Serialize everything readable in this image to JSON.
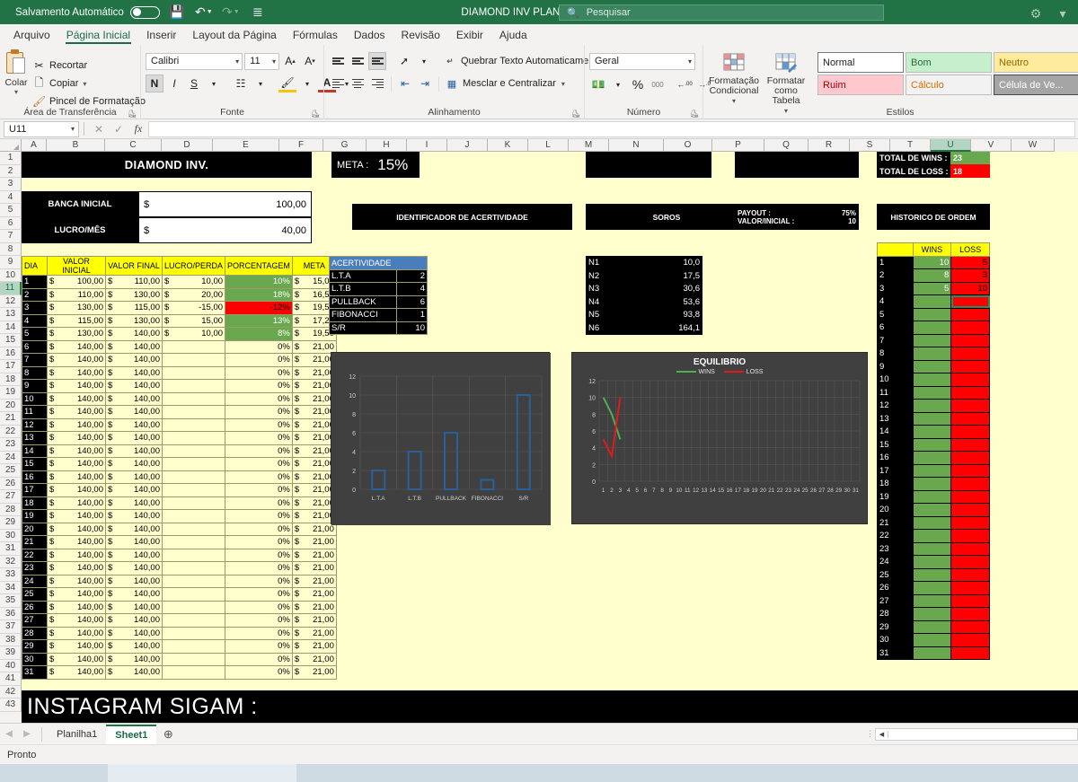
{
  "titlebar": {
    "autosave_label": "Salvamento Automático",
    "autosave_state": "off",
    "save_icon": "save-icon",
    "undo_icon": "undo-icon",
    "redo_icon": "redo-icon",
    "customize_icon": "customize-quick-access-icon",
    "document_title": "DIAMOND INV PLANILHA  -  Excel",
    "search_placeholder": "Pesquisar",
    "accent_color": "#217346"
  },
  "ribbon_tabs": [
    {
      "label": "Arquivo",
      "active": false
    },
    {
      "label": "Página Inicial",
      "active": true
    },
    {
      "label": "Inserir",
      "active": false
    },
    {
      "label": "Layout da Página",
      "active": false
    },
    {
      "label": "Fórmulas",
      "active": false
    },
    {
      "label": "Dados",
      "active": false
    },
    {
      "label": "Revisão",
      "active": false
    },
    {
      "label": "Exibir",
      "active": false
    },
    {
      "label": "Ajuda",
      "active": false
    }
  ],
  "ribbon": {
    "clipboard": {
      "group_label": "Área de Transferência",
      "paste_label": "Colar",
      "cut_label": "Recortar",
      "copy_label": "Copiar",
      "format_painter_label": "Pincel de Formatação"
    },
    "font": {
      "group_label": "Fonte",
      "font_family": "Calibri",
      "font_size": "11",
      "grow_label": "A",
      "shrink_label": "A",
      "bold_label": "N",
      "italic_label": "I",
      "underline_label": "S"
    },
    "alignment": {
      "group_label": "Alinhamento",
      "wrap_text_label": "Quebrar Texto Automaticamente",
      "merge_label": "Mesclar e Centralizar"
    },
    "number": {
      "group_label": "Número",
      "format": "Geral",
      "percent_label": "%",
      "comma_label": "000"
    },
    "styles": {
      "group_label": "Estilos",
      "conditional_label": "Formatação Condicional",
      "table_label": "Formatar como Tabela",
      "cells": [
        {
          "label": "Normal",
          "kind": "normal"
        },
        {
          "label": "Bom",
          "kind": "bom"
        },
        {
          "label": "Neutro",
          "kind": "neutro"
        },
        {
          "label": "Ruim",
          "kind": "ruim"
        },
        {
          "label": "Cálculo",
          "kind": "calc"
        },
        {
          "label": "Célula de Ve...",
          "kind": "cel"
        }
      ]
    }
  },
  "formula_bar": {
    "name_box": "U11",
    "cancel_icon": "cancel-icon",
    "confirm_icon": "confirm-icon",
    "function_icon": "fx",
    "formula_value": ""
  },
  "grid": {
    "columns": [
      "A",
      "B",
      "C",
      "D",
      "E",
      "F",
      "G",
      "H",
      "I",
      "J",
      "K",
      "L",
      "M",
      "N",
      "O",
      "P",
      "Q",
      "R",
      "S",
      "T",
      "U",
      "V",
      "W"
    ],
    "selected_column": "U",
    "selected_row": 11,
    "rows_visible": 43,
    "background_color": "#ffffcd"
  },
  "sheet": {
    "main_title": "DIAMOND INV.",
    "banca_inicial_label": "BANCA INICIAL",
    "banca_inicial_value": "100,00",
    "lucro_mes_label": "LUCRO/MÊS",
    "lucro_mes_value": "40,00",
    "currency_symbol": "$",
    "meta_label": "META :",
    "meta_value": "15%",
    "identificador_label": "IDENTIFICADOR DE ACERTIVIDADE",
    "soros_label": "SOROS",
    "payout_label": "PAYOUT :",
    "payout_value": "75%",
    "valor_inicial_label": "VALOR/INICIAL :",
    "valor_inicial_value": "10",
    "total_wins_label": "TOTAL DE WINS :",
    "total_wins_value": "23",
    "total_loss_label": "TOTAL DE LOSS :",
    "total_loss_value": "18",
    "historico_label": "HISTORICO DE ORDEM",
    "instagram_label": "INSTAGRAM SIGAM :"
  },
  "main_table": {
    "headers": [
      "DIA",
      "VALOR INICIAL",
      "VALOR FINAL",
      "LUCRO/PERDA",
      "PORCENTAGEM",
      "META"
    ],
    "rows": [
      {
        "dia": "1",
        "inicial": "100,00",
        "final": "110,00",
        "lucro": "10,00",
        "pct": "10%",
        "pct_state": "win",
        "meta": "15,00"
      },
      {
        "dia": "2",
        "inicial": "110,00",
        "final": "130,00",
        "lucro": "20,00",
        "pct": "18%",
        "pct_state": "win",
        "meta": "16,50"
      },
      {
        "dia": "3",
        "inicial": "130,00",
        "final": "115,00",
        "lucro": "-15,00",
        "pct": "-12%",
        "pct_state": "loss",
        "meta": "19,50"
      },
      {
        "dia": "4",
        "inicial": "115,00",
        "final": "130,00",
        "lucro": "15,00",
        "pct": "13%",
        "pct_state": "win",
        "meta": "17,25"
      },
      {
        "dia": "5",
        "inicial": "130,00",
        "final": "140,00",
        "lucro": "10,00",
        "pct": "8%",
        "pct_state": "win",
        "meta": "19,50"
      },
      {
        "dia": "6",
        "inicial": "140,00",
        "final": "140,00",
        "lucro": "",
        "pct": "0%",
        "pct_state": "none",
        "meta": "21,00"
      },
      {
        "dia": "7",
        "inicial": "140,00",
        "final": "140,00",
        "lucro": "",
        "pct": "0%",
        "pct_state": "none",
        "meta": "21,00"
      },
      {
        "dia": "8",
        "inicial": "140,00",
        "final": "140,00",
        "lucro": "",
        "pct": "0%",
        "pct_state": "none",
        "meta": "21,00"
      },
      {
        "dia": "9",
        "inicial": "140,00",
        "final": "140,00",
        "lucro": "",
        "pct": "0%",
        "pct_state": "none",
        "meta": "21,00"
      },
      {
        "dia": "10",
        "inicial": "140,00",
        "final": "140,00",
        "lucro": "",
        "pct": "0%",
        "pct_state": "none",
        "meta": "21,00"
      },
      {
        "dia": "11",
        "inicial": "140,00",
        "final": "140,00",
        "lucro": "",
        "pct": "0%",
        "pct_state": "none",
        "meta": "21,00"
      },
      {
        "dia": "12",
        "inicial": "140,00",
        "final": "140,00",
        "lucro": "",
        "pct": "0%",
        "pct_state": "none",
        "meta": "21,00"
      },
      {
        "dia": "13",
        "inicial": "140,00",
        "final": "140,00",
        "lucro": "",
        "pct": "0%",
        "pct_state": "none",
        "meta": "21,00"
      },
      {
        "dia": "14",
        "inicial": "140,00",
        "final": "140,00",
        "lucro": "",
        "pct": "0%",
        "pct_state": "none",
        "meta": "21,00"
      },
      {
        "dia": "15",
        "inicial": "140,00",
        "final": "140,00",
        "lucro": "",
        "pct": "0%",
        "pct_state": "none",
        "meta": "21,00"
      },
      {
        "dia": "16",
        "inicial": "140,00",
        "final": "140,00",
        "lucro": "",
        "pct": "0%",
        "pct_state": "none",
        "meta": "21,00"
      },
      {
        "dia": "17",
        "inicial": "140,00",
        "final": "140,00",
        "lucro": "",
        "pct": "0%",
        "pct_state": "none",
        "meta": "21,00"
      },
      {
        "dia": "18",
        "inicial": "140,00",
        "final": "140,00",
        "lucro": "",
        "pct": "0%",
        "pct_state": "none",
        "meta": "21,00"
      },
      {
        "dia": "19",
        "inicial": "140,00",
        "final": "140,00",
        "lucro": "",
        "pct": "0%",
        "pct_state": "none",
        "meta": "21,00"
      },
      {
        "dia": "20",
        "inicial": "140,00",
        "final": "140,00",
        "lucro": "",
        "pct": "0%",
        "pct_state": "none",
        "meta": "21,00"
      },
      {
        "dia": "21",
        "inicial": "140,00",
        "final": "140,00",
        "lucro": "",
        "pct": "0%",
        "pct_state": "none",
        "meta": "21,00"
      },
      {
        "dia": "22",
        "inicial": "140,00",
        "final": "140,00",
        "lucro": "",
        "pct": "0%",
        "pct_state": "none",
        "meta": "21,00"
      },
      {
        "dia": "23",
        "inicial": "140,00",
        "final": "140,00",
        "lucro": "",
        "pct": "0%",
        "pct_state": "none",
        "meta": "21,00"
      },
      {
        "dia": "24",
        "inicial": "140,00",
        "final": "140,00",
        "lucro": "",
        "pct": "0%",
        "pct_state": "none",
        "meta": "21,00"
      },
      {
        "dia": "25",
        "inicial": "140,00",
        "final": "140,00",
        "lucro": "",
        "pct": "0%",
        "pct_state": "none",
        "meta": "21,00"
      },
      {
        "dia": "26",
        "inicial": "140,00",
        "final": "140,00",
        "lucro": "",
        "pct": "0%",
        "pct_state": "none",
        "meta": "21,00"
      },
      {
        "dia": "27",
        "inicial": "140,00",
        "final": "140,00",
        "lucro": "",
        "pct": "0%",
        "pct_state": "none",
        "meta": "21,00"
      },
      {
        "dia": "28",
        "inicial": "140,00",
        "final": "140,00",
        "lucro": "",
        "pct": "0%",
        "pct_state": "none",
        "meta": "21,00"
      },
      {
        "dia": "29",
        "inicial": "140,00",
        "final": "140,00",
        "lucro": "",
        "pct": "0%",
        "pct_state": "none",
        "meta": "21,00"
      },
      {
        "dia": "30",
        "inicial": "140,00",
        "final": "140,00",
        "lucro": "",
        "pct": "0%",
        "pct_state": "none",
        "meta": "21,00"
      },
      {
        "dia": "31",
        "inicial": "140,00",
        "final": "140,00",
        "lucro": "",
        "pct": "0%",
        "pct_state": "none",
        "meta": "21,00"
      }
    ]
  },
  "acertividade": {
    "header": "ACERTIVIDADE",
    "rows": [
      {
        "label": "L.T.A",
        "value": "2"
      },
      {
        "label": "L.T.B",
        "value": "4"
      },
      {
        "label": "PULLBACK",
        "value": "6"
      },
      {
        "label": "FIBONACCI",
        "value": "1"
      },
      {
        "label": "S/R",
        "value": "10"
      }
    ]
  },
  "soros_table": {
    "rows": [
      {
        "label": "N1",
        "value": "10,0"
      },
      {
        "label": "N2",
        "value": "17,5"
      },
      {
        "label": "N3",
        "value": "30,6"
      },
      {
        "label": "N4",
        "value": "53,6"
      },
      {
        "label": "N5",
        "value": "93,8"
      },
      {
        "label": "N6",
        "value": "164,1"
      }
    ]
  },
  "historico_table": {
    "headers": [
      "",
      "WINS",
      "LOSS"
    ],
    "rows": [
      {
        "n": "1",
        "wins": "10",
        "loss": "5"
      },
      {
        "n": "2",
        "wins": "8",
        "loss": "3"
      },
      {
        "n": "3",
        "wins": "5",
        "loss": "10"
      },
      {
        "n": "4",
        "wins": "",
        "loss": "",
        "selected": true
      },
      {
        "n": "5",
        "wins": "",
        "loss": ""
      },
      {
        "n": "6",
        "wins": "",
        "loss": ""
      },
      {
        "n": "7",
        "wins": "",
        "loss": ""
      },
      {
        "n": "8",
        "wins": "",
        "loss": ""
      },
      {
        "n": "9",
        "wins": "",
        "loss": ""
      },
      {
        "n": "10",
        "wins": "",
        "loss": ""
      },
      {
        "n": "11",
        "wins": "",
        "loss": ""
      },
      {
        "n": "12",
        "wins": "",
        "loss": ""
      },
      {
        "n": "13",
        "wins": "",
        "loss": ""
      },
      {
        "n": "14",
        "wins": "",
        "loss": ""
      },
      {
        "n": "15",
        "wins": "",
        "loss": ""
      },
      {
        "n": "16",
        "wins": "",
        "loss": ""
      },
      {
        "n": "17",
        "wins": "",
        "loss": ""
      },
      {
        "n": "18",
        "wins": "",
        "loss": ""
      },
      {
        "n": "19",
        "wins": "",
        "loss": ""
      },
      {
        "n": "20",
        "wins": "",
        "loss": ""
      },
      {
        "n": "21",
        "wins": "",
        "loss": ""
      },
      {
        "n": "22",
        "wins": "",
        "loss": ""
      },
      {
        "n": "23",
        "wins": "",
        "loss": ""
      },
      {
        "n": "24",
        "wins": "",
        "loss": ""
      },
      {
        "n": "25",
        "wins": "",
        "loss": ""
      },
      {
        "n": "26",
        "wins": "",
        "loss": ""
      },
      {
        "n": "27",
        "wins": "",
        "loss": ""
      },
      {
        "n": "28",
        "wins": "",
        "loss": ""
      },
      {
        "n": "29",
        "wins": "",
        "loss": ""
      },
      {
        "n": "30",
        "wins": "",
        "loss": ""
      },
      {
        "n": "31",
        "wins": "",
        "loss": ""
      }
    ]
  },
  "chart_data": [
    {
      "type": "bar",
      "title": "",
      "categories": [
        "L.T.A",
        "L.T.B",
        "PULLBACK",
        "FIBONACCI",
        "S/R"
      ],
      "values": [
        2,
        4,
        6,
        1,
        10
      ],
      "xlabel": "",
      "ylabel": "",
      "ylim": [
        0,
        12
      ],
      "yticks": [
        0,
        2,
        4,
        6,
        8,
        10,
        12
      ],
      "grid": true,
      "legend": "none",
      "bar_color": "#2a6099",
      "plot_bg": "#404040"
    },
    {
      "type": "line",
      "title": "EQUILIBRIO",
      "x": [
        1,
        2,
        3,
        4,
        5,
        6,
        7,
        8,
        9,
        10,
        11,
        12,
        13,
        14,
        15,
        16,
        17,
        18,
        19,
        20,
        21,
        22,
        23,
        24,
        25,
        26,
        27,
        28,
        29,
        30,
        31
      ],
      "series": [
        {
          "name": "WINS",
          "color": "#4caf50",
          "values": [
            10,
            8,
            5
          ]
        },
        {
          "name": "LOSS",
          "color": "#e01b1b",
          "values": [
            5,
            3,
            10
          ]
        }
      ],
      "xlabel": "",
      "ylabel": "",
      "ylim": [
        0,
        12
      ],
      "yticks": [
        0,
        2,
        4,
        6,
        8,
        10,
        12
      ],
      "grid": true,
      "legend": "top",
      "plot_bg": "#404040"
    }
  ],
  "sheet_tabs": {
    "prev_icon": "nav-prev-icon",
    "next_icon": "nav-next-icon",
    "tabs": [
      {
        "label": "Planilha1",
        "active": false
      },
      {
        "label": "Sheet1",
        "active": true
      }
    ],
    "add_icon": "add-sheet-icon"
  },
  "status_bar": {
    "status_text": "Pronto"
  }
}
